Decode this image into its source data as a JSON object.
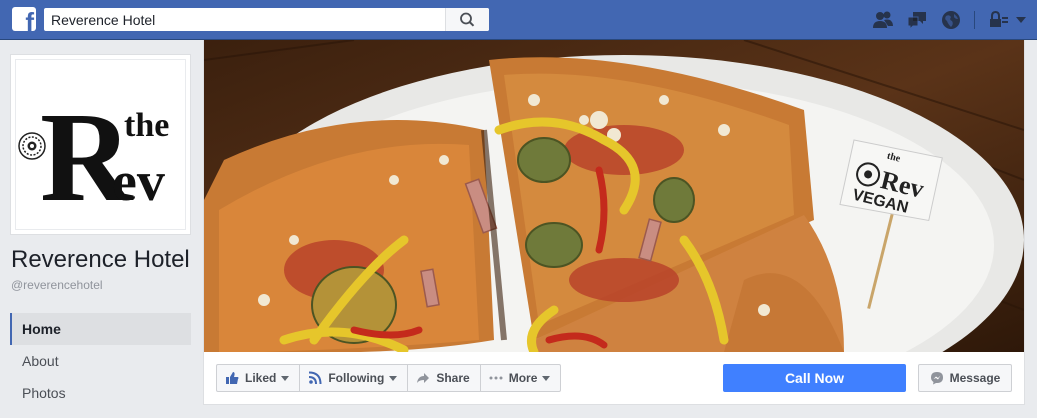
{
  "search": {
    "value": "Reverence Hotel"
  },
  "top_icons": [
    "friend-requests-icon",
    "messages-icon",
    "notifications-globe-icon",
    "privacy-lock-icon",
    "account-menu-icon"
  ],
  "page": {
    "name": "Reverence Hotel",
    "handle": "@reverencehotel",
    "logo_text": {
      "the": "the",
      "r": "R",
      "ev": "ev"
    }
  },
  "nav": {
    "items": [
      {
        "label": "Home",
        "active": true
      },
      {
        "label": "About",
        "active": false
      },
      {
        "label": "Photos",
        "active": false
      }
    ]
  },
  "cover": {
    "flag_text": {
      "line1": "the",
      "line2": "Rev",
      "line3": "VEGAN"
    }
  },
  "actions": {
    "liked": "Liked",
    "following": "Following",
    "share": "Share",
    "more": "More",
    "call_now": "Call Now",
    "message": "Message"
  },
  "colors": {
    "brand": "#4267b2",
    "call_button": "#4080ff",
    "page_bg": "#e9ebee"
  }
}
